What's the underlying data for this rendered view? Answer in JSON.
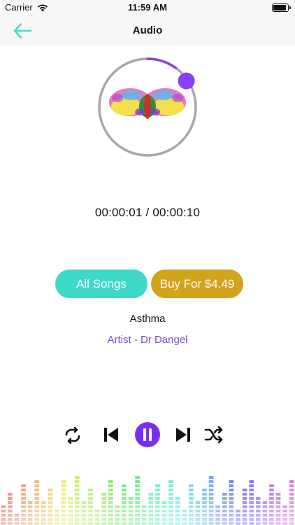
{
  "status": {
    "carrier": "Carrier",
    "time": "11:59 AM",
    "battery_level": 1.0
  },
  "nav": {
    "title": "Audio"
  },
  "player": {
    "elapsed_total": "00:00:01 / 00:00:10",
    "progress": 0.1,
    "song_title": "Asthma",
    "artist": "Artist - Dr Dangel"
  },
  "buttons": {
    "all_songs": "All Songs",
    "buy": "Buy For $4.49"
  },
  "controls": {
    "repeat_icon": "repeat-icon",
    "previous_icon": "previous-icon",
    "pause_icon": "pause-icon",
    "next_icon": "next-icon",
    "shuffle_icon": "shuffle-icon"
  },
  "colors": {
    "accent_teal": "#3fd9cc",
    "buy_gold": "#d2a31c",
    "artist_purple": "#7b4fd4",
    "progress_knob": "#8a3ff0",
    "ring_gray": "#a7a7a7"
  }
}
